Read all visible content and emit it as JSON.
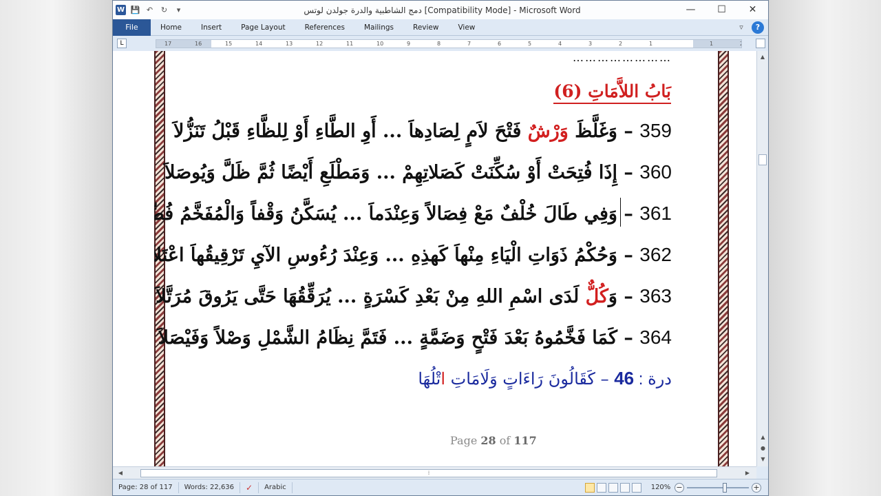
{
  "window": {
    "title": "دمج الشاطبية والدرة جولدن لوتس [Compatibility Mode]  -  Microsoft Word",
    "minimize_glyph": "—",
    "maximize_glyph": "☐",
    "close_glyph": "✕"
  },
  "qat": {
    "word_logo": "W",
    "save_glyph": "💾",
    "undo_glyph": "↶",
    "redo_glyph": "↻",
    "customize_glyph": "▾"
  },
  "ribbon": {
    "file_label": "File",
    "tabs": [
      "Home",
      "Insert",
      "Page Layout",
      "References",
      "Mailings",
      "Review",
      "View"
    ],
    "minimize_glyph": "▿",
    "help_glyph": "?"
  },
  "ruler": {
    "tab_selector": "L",
    "numbers": [
      "17",
      "16",
      "15",
      "14",
      "13",
      "12",
      "11",
      "10",
      "9",
      "8",
      "7",
      "6",
      "5",
      "4",
      "3",
      "2",
      "1",
      "",
      "1",
      "2"
    ]
  },
  "document": {
    "dots": "……………………",
    "chapter_title": "بَابُ اللاَّمَاتِ (6)",
    "verses": [
      {
        "num": "359",
        "dash": " – ",
        "pre": "وَغَلَّظَ ",
        "red": "وَرْشٌ",
        "post": " فَتْحَ لاَمٍ لِصَادِهاَ ... أَوِ الطَّاءِ أَوْ لِلظَّاءِ قَبْلُ تَنَزُّلاَ"
      },
      {
        "num": "360",
        "dash": " – ",
        "pre": "إِذَا فُتِحَتْ أَوْ سُكِّنَتْ كَصَلاتِهِمْ ... وَمَطْلَعِ أَيْضًا ثُمَّ ظَلَّ وَيُوصَلاَ",
        "red": "",
        "post": ""
      },
      {
        "num": "361",
        "dash": " – ",
        "pre": "وَفِي طَالَ خُلْفٌ مَعْ فِصَالاً وَعِنْدَماَ ... يُسَكَّنُ وَقْفاً وَالْمُفَخَّمُ فُضِّلاَ",
        "red": "",
        "post": ""
      },
      {
        "num": "362",
        "dash": " – ",
        "pre": "وَحُكْمُ ذَوَاتِ الْيَاءِ مِنْهاَ كَهذِهِ ... وَعِنْدَ رُءُوسِ الآيِ تَرْقِيقُهاَ اعْتَلاَ",
        "red": "",
        "post": ""
      },
      {
        "num": "363",
        "dash": " – ",
        "pre": "وَ",
        "red": "كُلٌّ",
        "post": " لَدَى اسْمِ اللهِ مِنْ بَعْدِ كَسْرَةٍ ... يُرَقِّقُهَا حَتَّى يَرُوقَ مُرَتَّلاَ"
      },
      {
        "num": "364",
        "dash": " – ",
        "pre": "كَمَا فَخَّمُوهُ بَعْدَ فَتْحٍ وَضَمَّةٍ ... فَتَمَّ نِظَامُ الشَّمْلِ وَصْلاً وَفَيْصَلاَ",
        "red": "",
        "post": ""
      }
    ],
    "durra": {
      "label": "درة : ",
      "num": "46",
      "dash": " – ",
      "pre": "كَقَالُونَ رَاءَاتٍ وَلَامَاتِ ",
      "red": "ا",
      "post": "تْلُهَا"
    },
    "page_prefix": "Page ",
    "page_current": "28",
    "page_of": " of ",
    "page_total": "117"
  },
  "statusbar": {
    "page": "Page: 28 of 117",
    "words": "Words: 22,636",
    "language": "Arabic",
    "zoom": "120%",
    "zoom_out": "−",
    "zoom_in": "+"
  }
}
